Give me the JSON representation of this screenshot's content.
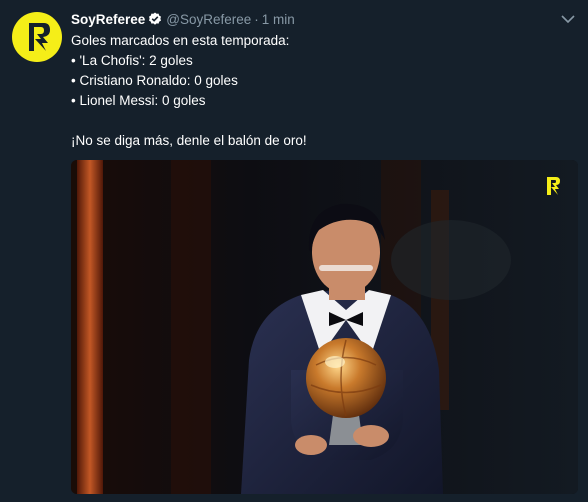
{
  "tweet": {
    "author": {
      "name": "SoyReferee",
      "handle": "@SoyReferee",
      "verified": true,
      "avatar_icon": "soyreferee-logo-icon"
    },
    "separator": "·",
    "time": "1 min",
    "text_lines": [
      "Goles marcados en esta temporada:",
      "• 'La Chofis': 2 goles",
      "• Cristiano Ronaldo: 0 goles",
      "• Lionel Messi: 0 goles",
      "¡No se diga más, denle el balón de oro!"
    ],
    "menu_icon": "chevron-down-icon",
    "media": {
      "watermark_icon": "soyreferee-logo-icon"
    }
  },
  "colors": {
    "background": "#15202b",
    "text": "#ffffff",
    "secondary_text": "#8899a6",
    "brand_yellow": "#f5ee18",
    "verified_badge": "#ffffff"
  }
}
